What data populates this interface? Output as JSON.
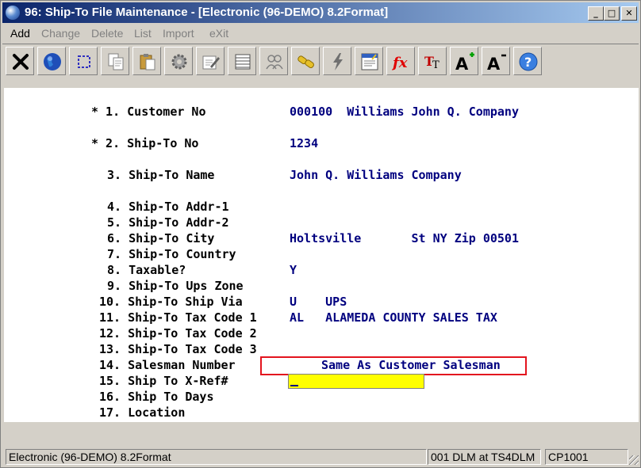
{
  "window": {
    "title": "96: Ship-To File Maintenance - [Electronic (96-DEMO) 8.2Format]",
    "minimize_glyph": "_",
    "maximize_glyph": "□",
    "close_glyph": "✕"
  },
  "menu": [
    {
      "label": "Add",
      "enabled": true
    },
    {
      "label": "Change",
      "enabled": false
    },
    {
      "label": "Delete",
      "enabled": false
    },
    {
      "label": "List",
      "enabled": false
    },
    {
      "label": "Import",
      "enabled": false
    },
    {
      "label": "eXit",
      "enabled": false
    }
  ],
  "toolbar": [
    {
      "icon": "close-x-icon"
    },
    {
      "icon": "globe-icon"
    },
    {
      "icon": "select-box-icon"
    },
    {
      "icon": "copy-icon"
    },
    {
      "icon": "paste-icon"
    },
    {
      "icon": "settings-gear-icon"
    },
    {
      "icon": "edit-form-icon"
    },
    {
      "icon": "list-icon"
    },
    {
      "icon": "users-icon"
    },
    {
      "icon": "link-icon"
    },
    {
      "icon": "lightning-icon"
    },
    {
      "icon": "report-icon"
    },
    {
      "icon": "function-icon",
      "text": "fx"
    },
    {
      "icon": "font-icon",
      "text": "TT"
    },
    {
      "icon": "font-increase-icon",
      "text": "A"
    },
    {
      "icon": "font-decrease-icon",
      "text": "A"
    },
    {
      "icon": "help-icon",
      "text": "?"
    }
  ],
  "form": {
    "f1_label": "* 1. Customer No",
    "f1_value": "000100  Williams John Q. Company",
    "f2_label": "* 2. Ship-To No",
    "f2_value": "1234",
    "f3_label": "3. Ship-To Name",
    "f3_value": "John Q. Williams Company",
    "f4_label": "4. Ship-To Addr-1",
    "f5_label": "5. Ship-To Addr-2",
    "f6_label": "6. Ship-To City",
    "f6_value": "Holtsville       St NY Zip 00501",
    "f7_label": "7. Ship-To Country",
    "f8_label": "8. Taxable?",
    "f8_value": "Y",
    "f9_label": "9. Ship-To Ups Zone",
    "f10_label": "10. Ship-To Ship Via",
    "f10_value": "U    UPS",
    "f11_label": "11. Ship-To Tax Code 1",
    "f11_value": "AL   ALAMEDA COUNTY SALES TAX",
    "f12_label": "12. Ship-To Tax Code 2",
    "f13_label": "13. Ship-To Tax Code 3",
    "f14_label": "14. Salesman Number",
    "f14_value": "Same As Customer Salesman",
    "f15_label": "15. Ship To X-Ref#",
    "f15_value": "",
    "f16_label": "16. Ship To Days",
    "f17_label": "17. Location"
  },
  "status": {
    "left": "Electronic (96-DEMO) 8.2Format",
    "middle": "001 DLM at TS4DLM",
    "right": "CP1001"
  },
  "colors": {
    "titlebar_start": "#0a246a",
    "titlebar_end": "#a6caf0",
    "value_text": "#00007f",
    "highlight_box": "#e3141e",
    "input_bg": "#ffff00"
  }
}
